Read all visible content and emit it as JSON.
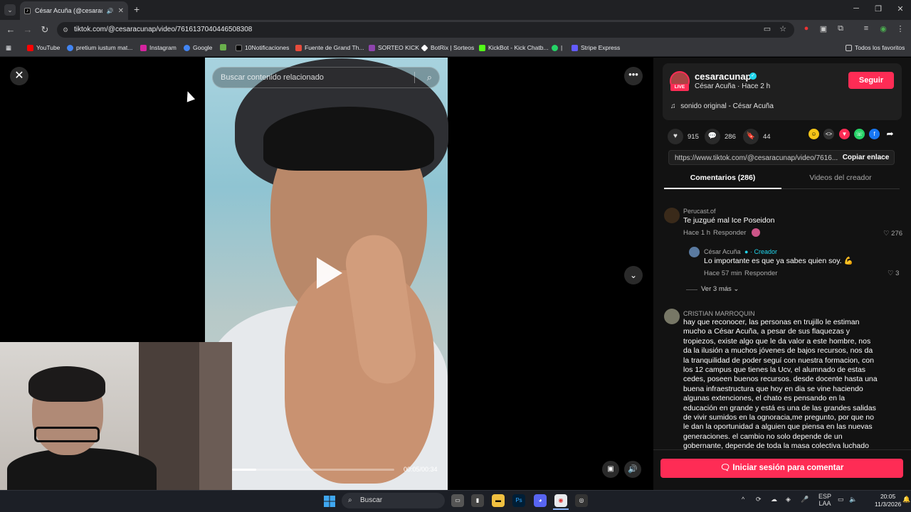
{
  "browser": {
    "tab_title": "César Acuña (@cesaracunap",
    "address": "tiktok.com/@cesaracunap/video/7616137040446508308",
    "bookmarks": [
      {
        "label": "YouTube",
        "color": "#ff0000"
      },
      {
        "label": "pretium iustum mat...",
        "color": "#4285f4"
      },
      {
        "label": "Instagram",
        "color": "#d6249f"
      },
      {
        "label": "Google",
        "color": "#4285f4"
      },
      {
        "label": "",
        "color": "#6ab04c"
      },
      {
        "label": "10Notificaciones",
        "color": "#000000"
      },
      {
        "label": "Fuente de Grand Th...",
        "color": "#e74c3c"
      },
      {
        "label": "SORTEO KICK",
        "color": "#8e44ad"
      },
      {
        "label": "BotRix | Sorteos",
        "color": "#ffffff"
      },
      {
        "label": "KickBot - Kick Chatb...",
        "color": "#53fc18"
      },
      {
        "label": "|",
        "color": "#25d366"
      },
      {
        "label": "Stripe Express",
        "color": "#635bff"
      }
    ],
    "all_bookmarks": "Todos los favoritos"
  },
  "video": {
    "search_placeholder": "Buscar contenido relacionado",
    "timecode": "00:05/00:34",
    "progress": 0.147
  },
  "creator": {
    "username": "cesaracunap",
    "live_badge": "LIVE",
    "subline": "César Acuña · Hace 2 h",
    "follow_label": "Seguir",
    "music": "sonido original - César Acuña",
    "likes": "915",
    "comments": "286",
    "saves": "44",
    "link": "https://www.tiktok.com/@cesaracunap/video/7616...",
    "copy_label": "Copiar enlace"
  },
  "tabs": {
    "comments": "Comentarios (286)",
    "videos": "Videos del creador"
  },
  "comments": [
    {
      "author": "Perucast.of",
      "text": "Te juzgué mal Ice Poseidon",
      "time": "Hace 1 h",
      "reply": "Responder",
      "likes": "276",
      "replies": [
        {
          "author": "César Acuña",
          "creator_tag": "· Creador",
          "text": "Lo importante es que ya sabes quien soy. 💪",
          "time": "Hace 57 min",
          "reply": "Responder",
          "likes": "3"
        }
      ],
      "more": "Ver 3 más"
    },
    {
      "author": "CRISTIAN MARROQUIN",
      "text": "hay que reconocer, las personas en trujillo le estiman mucho a César Acuña, a pesar de sus flaquezas y tropiezos, existe algo que le da valor a este hombre, nos da la ilusión a muchos jóvenes de bajos recursos, nos da la tranquilidad de poder seguí con nuestra formacion, con los 12 campus que tienes la Ucv, el alumnado de estas cedes, poseen buenos recursos. desde docente hasta una buena infraestructura que hoy en dia se vine haciendo algunas extenciones, el chato es pensando en la educación en grande y está es una de las grandes salidas de vivir sumidos en la ognoracia,me pregunto, por que no le dan la oportunidad a alguien que piensa en las nuevas generaciones. el cambio no solo depende de un gobernante, depende de toda la masa colectiva luchado"
    }
  ],
  "login_label": "Iniciar sesión para comentar",
  "taskbar": {
    "search": "Buscar",
    "lang1": "ESP",
    "lang2": "LAA",
    "time": "20:05",
    "date": "11/3/2026"
  },
  "colors": {
    "accent": "#fe2c55",
    "verified": "#20d5ec"
  }
}
